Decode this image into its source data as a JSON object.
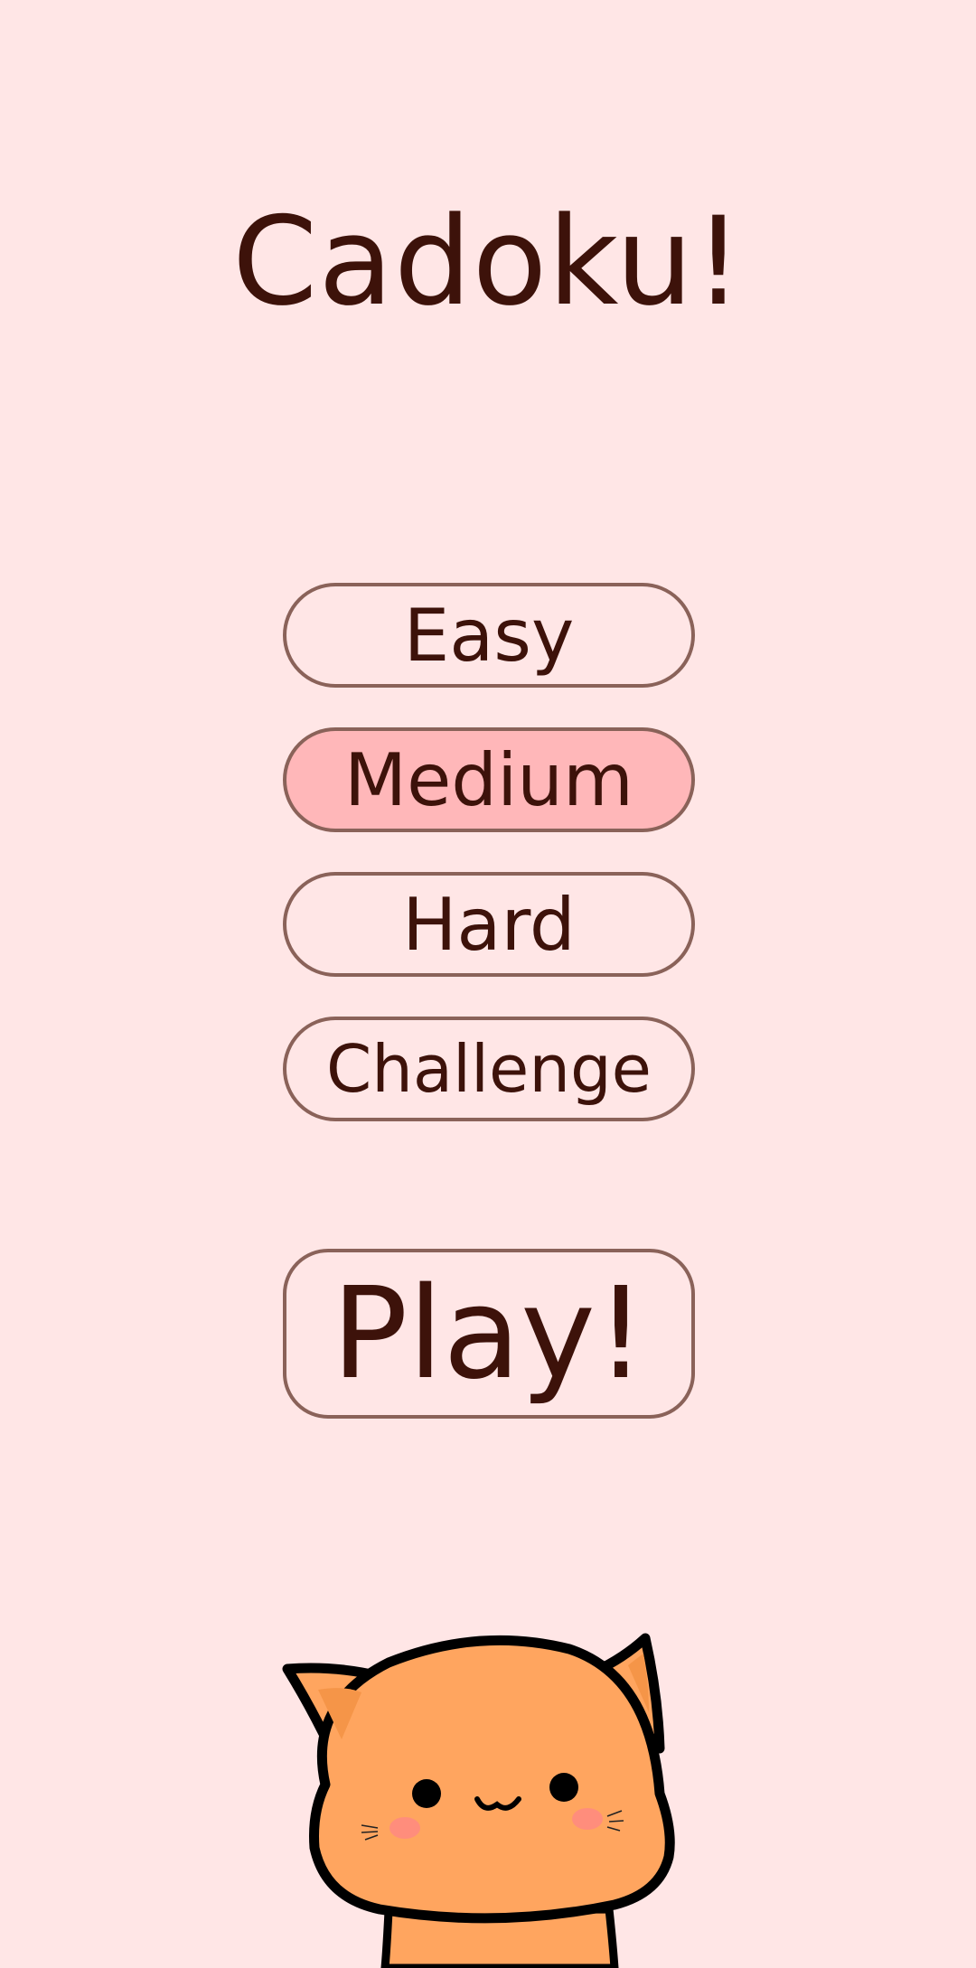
{
  "app": {
    "title": "Cadoku!"
  },
  "difficulty": {
    "options": [
      {
        "label": "Easy",
        "selected": false
      },
      {
        "label": "Medium",
        "selected": true
      },
      {
        "label": "Hard",
        "selected": false
      },
      {
        "label": "Challenge",
        "selected": false
      }
    ]
  },
  "play": {
    "label": "Play!"
  },
  "mascot": {
    "icon": "cat-mascot-icon"
  },
  "colors": {
    "background": "#ffe6e6",
    "text": "#3d120a",
    "button_border": "#8a6259",
    "selected_fill": "#ffb7b9",
    "cat_body": "#ffa55f"
  }
}
